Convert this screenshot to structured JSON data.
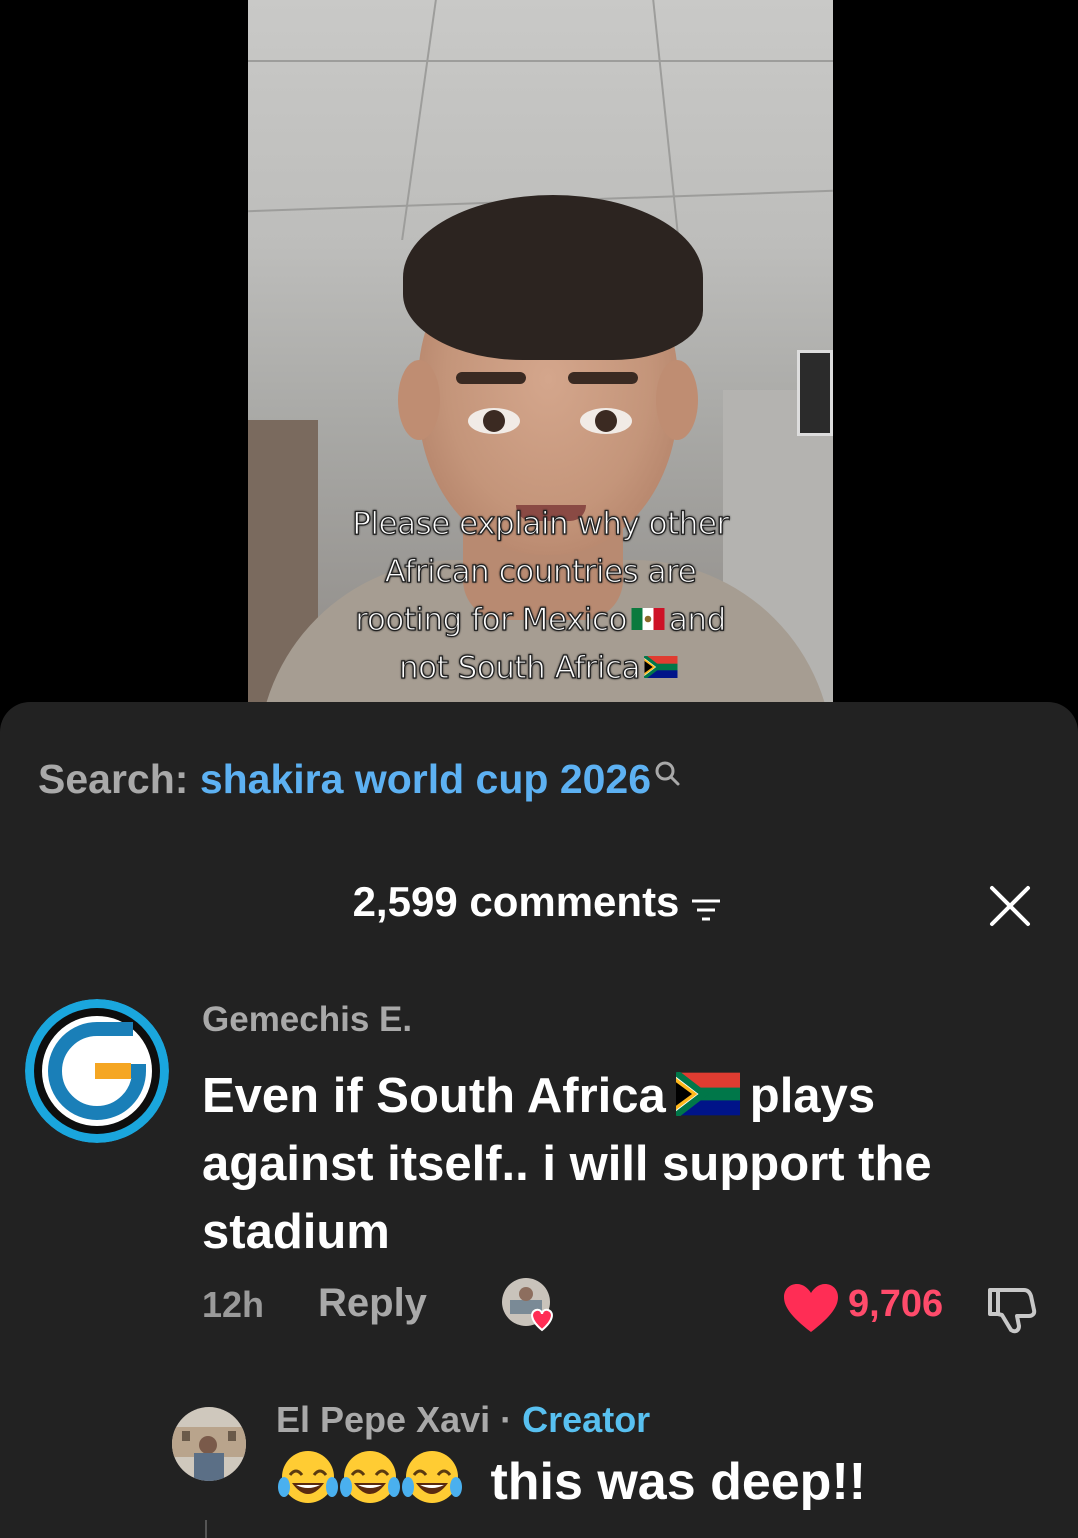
{
  "video": {
    "caption_lines": [
      "Please explain why other",
      "African countries are",
      "rooting for Mexico",
      "and",
      "not South Africa"
    ],
    "flag_icons": [
      "mexico-flag-icon",
      "south-africa-flag-icon"
    ]
  },
  "search": {
    "prefix": "Search:",
    "term": "shakira world cup 2026",
    "icon": "search-icon",
    "term_color": "#5db1f2"
  },
  "comments": {
    "count_label": "2,599 comments",
    "filter_icon": "filter-icon",
    "close_icon": "close-icon",
    "items": [
      {
        "author": "Gemechis E.",
        "text_before_flag": "Even if South Africa",
        "text_after_flag": "plays against itself.. i will support the stadium",
        "time": "12h",
        "reply_label": "Reply",
        "likes": "9,706",
        "liked_by_creator": true,
        "avatar_icon": "g-logo-avatar",
        "like_color": "#ff4b6b"
      }
    ],
    "reply": {
      "author": "El Pepe Xavi",
      "separator": "·",
      "badge": "Creator",
      "emojis": [
        "face-with-tears-of-joy-icon",
        "face-with-tears-of-joy-icon",
        "face-with-tears-of-joy-icon"
      ],
      "text": "this was deep!!",
      "badge_color": "#58c0f0"
    }
  }
}
